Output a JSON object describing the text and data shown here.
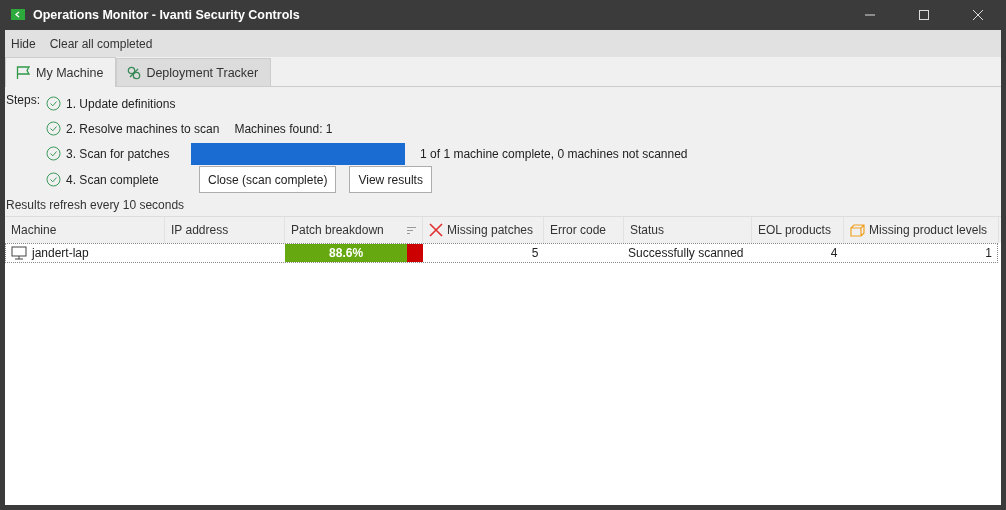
{
  "window": {
    "title": "Operations Monitor - Ivanti Security Controls"
  },
  "menu": [
    "Hide",
    "Clear all completed"
  ],
  "tabs": [
    {
      "label": "My Machine",
      "selected": true,
      "kind": "flag"
    },
    {
      "label": "Deployment Tracker",
      "selected": false,
      "kind": "tracker"
    }
  ],
  "steps_label": "Steps:",
  "steps": [
    {
      "label": "1. Update definitions",
      "done": true
    },
    {
      "label": "2. Resolve machines to scan",
      "done": true,
      "note": "Machines found: 1"
    },
    {
      "label": "3. Scan for patches",
      "done": true,
      "progress": {
        "level": 1
      },
      "note": "1 of 1 machine complete, 0 machines not scanned"
    },
    {
      "label": "4. Scan complete",
      "done": true,
      "buttons": [
        "Close (scan complete)",
        "View results"
      ]
    }
  ],
  "refresh_note": "Results refresh every 10 seconds",
  "table": {
    "columns": [
      {
        "label": "Machine",
        "kind": "plain"
      },
      {
        "label": "IP address",
        "kind": "plain"
      },
      {
        "label": "Patch breakdown",
        "kind": "sortable"
      },
      {
        "label": "Missing patches",
        "kind": "missing"
      },
      {
        "label": "Error code",
        "kind": "plain"
      },
      {
        "label": "Status",
        "kind": "plain"
      },
      {
        "label": "EOL products",
        "kind": "plain"
      },
      {
        "label": "Missing product levels",
        "kind": "product"
      }
    ],
    "rows": [
      {
        "machine": "jandert-lap",
        "patch_breakdown": {
          "label": "88.6%",
          "level": 0.886
        },
        "missing_patches": "5",
        "status": "Successfully scanned",
        "eol_products": "4",
        "missing_product_levels": "1"
      }
    ]
  }
}
